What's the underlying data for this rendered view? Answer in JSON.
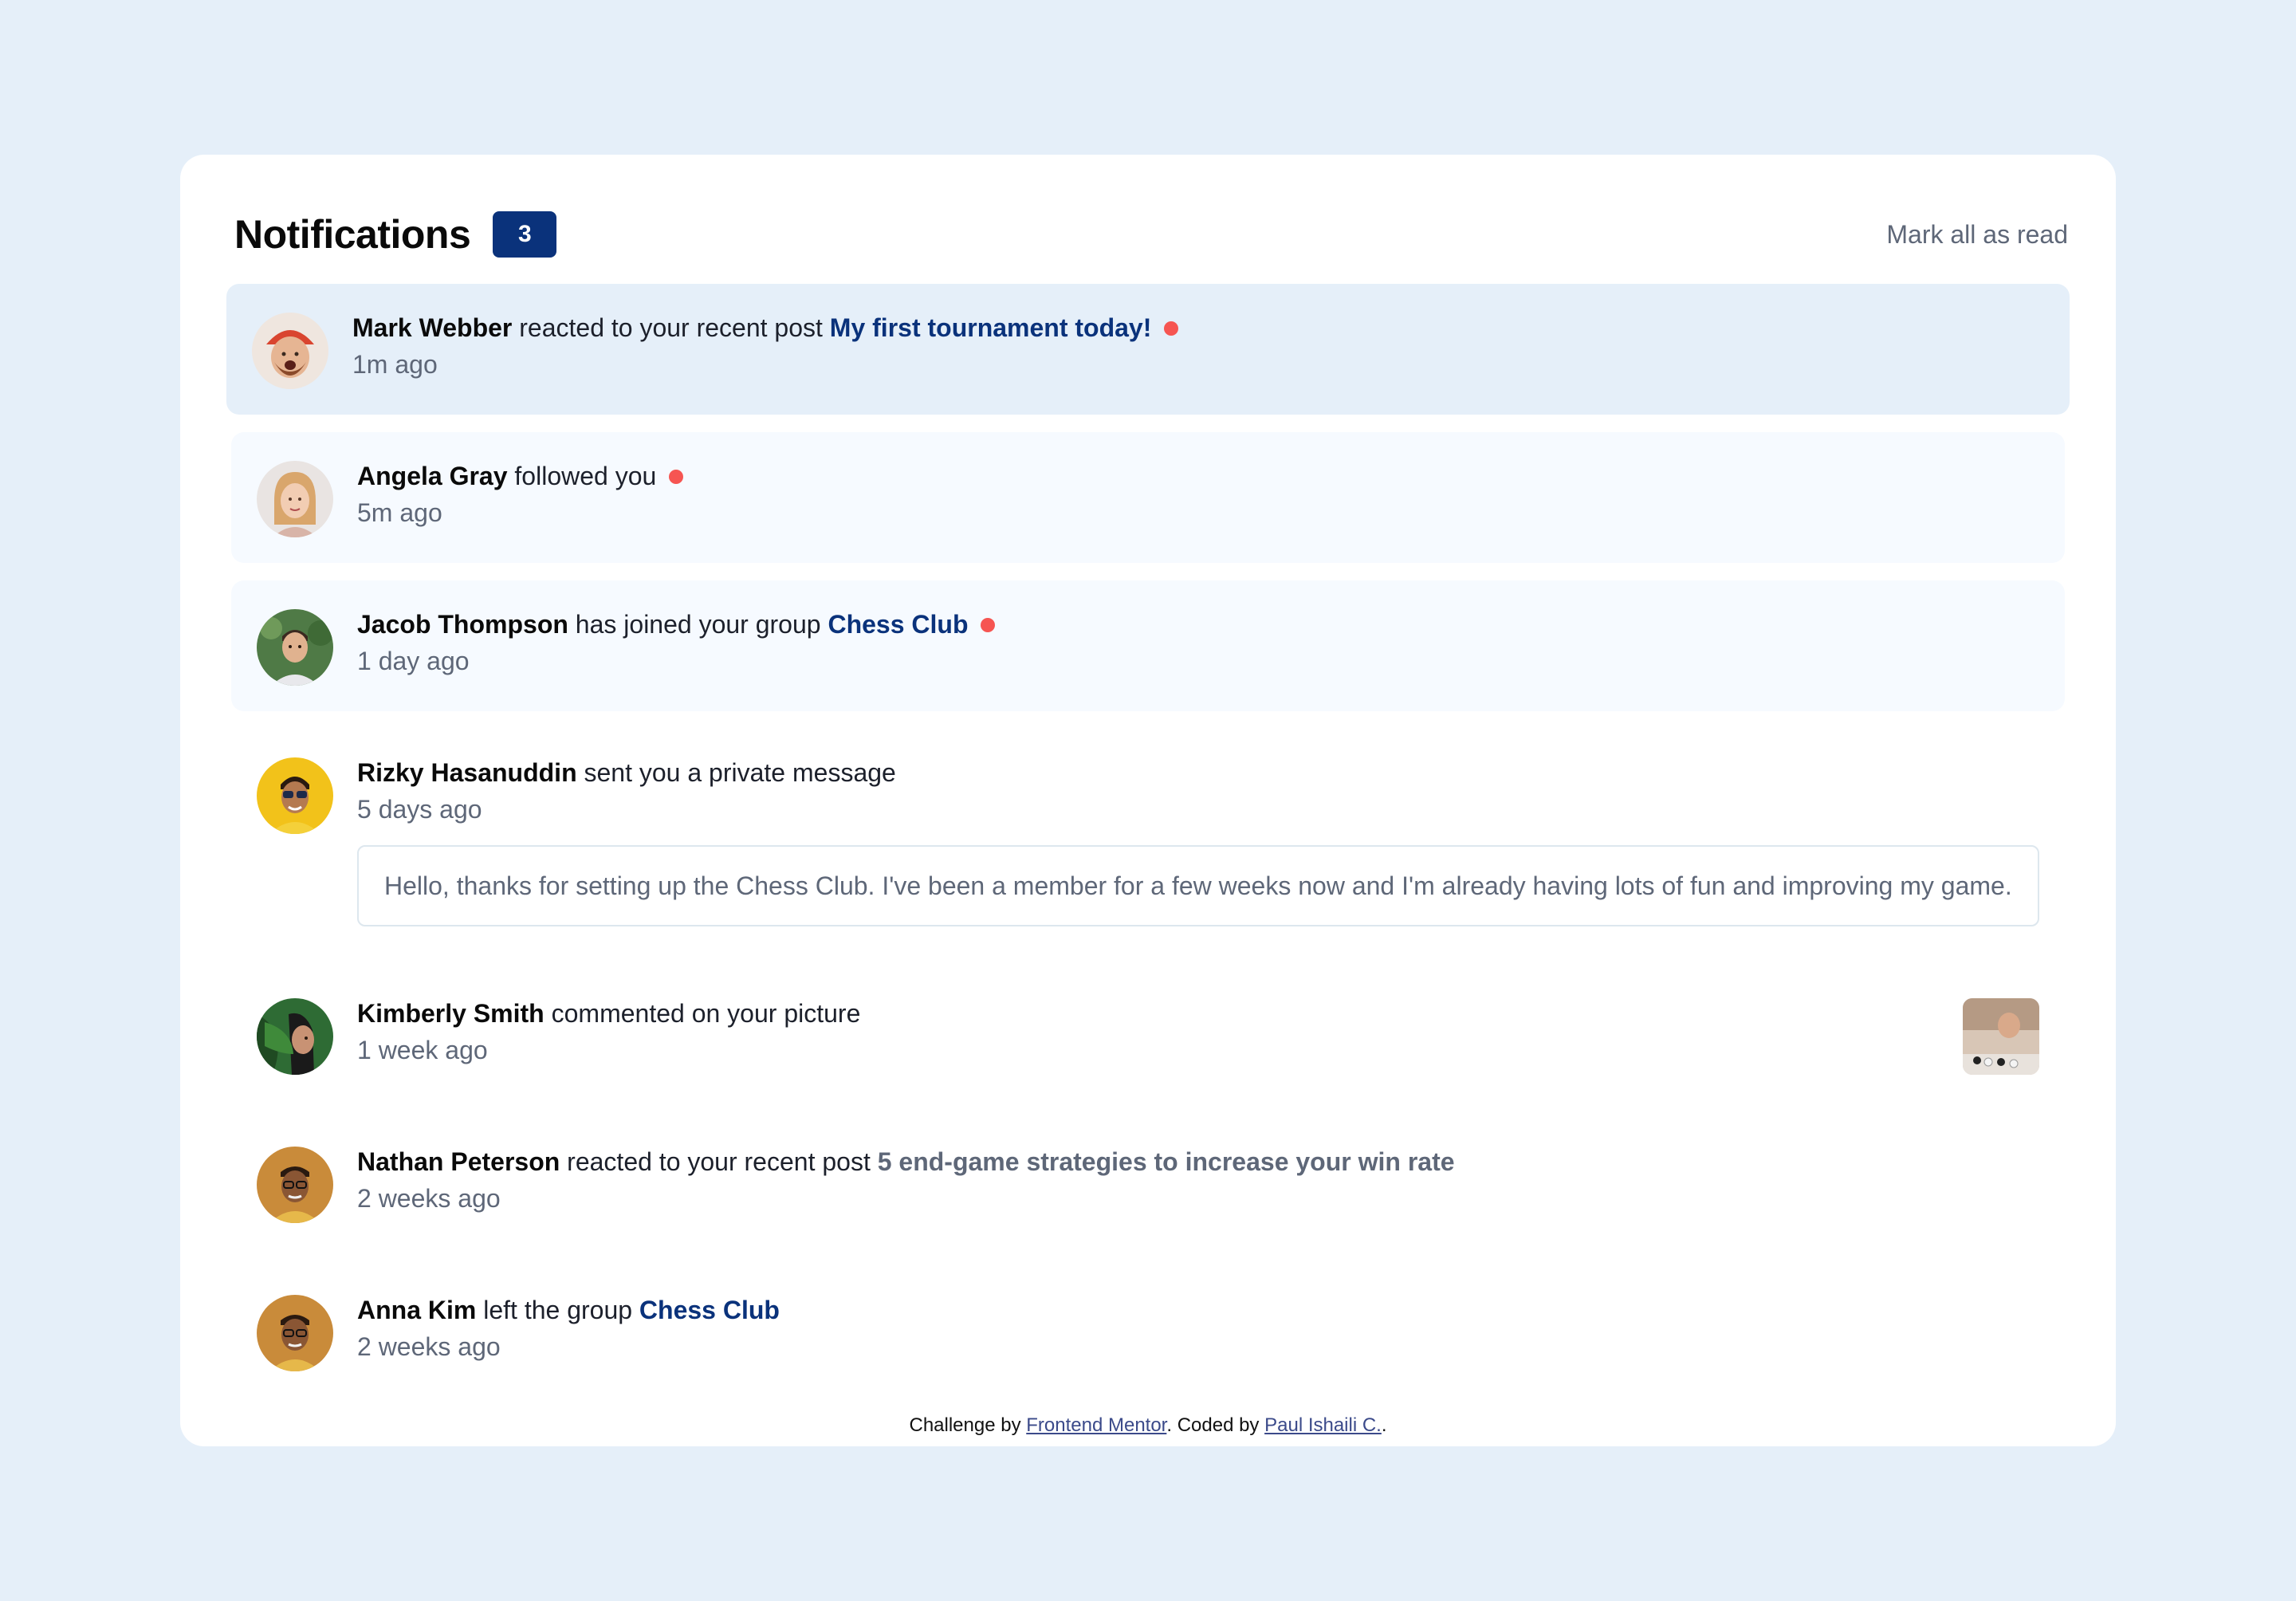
{
  "header": {
    "title": "Notifications",
    "unread_count": "3",
    "mark_all_label": "Mark all as read"
  },
  "notifications": [
    {
      "name": "Mark Webber",
      "action": " reacted to your recent post ",
      "target": "My first tournament today!",
      "time": "1m ago",
      "unread": true
    },
    {
      "name": "Angela Gray",
      "action": " followed you",
      "target": "",
      "time": "5m ago",
      "unread": true
    },
    {
      "name": "Jacob Thompson",
      "action": " has joined your group ",
      "target": "Chess Club",
      "time": "1 day ago",
      "unread": true
    },
    {
      "name": "Rizky Hasanuddin",
      "action": " sent you a private message",
      "target": "",
      "time": "5 days ago",
      "message": "Hello, thanks for setting up the Chess Club. I've been a member for a few weeks now and I'm already having lots of fun and improving my game.",
      "unread": false
    },
    {
      "name": "Kimberly Smith",
      "action": " commented on your picture",
      "target": "",
      "time": "1 week ago",
      "unread": false
    },
    {
      "name": "Nathan Peterson",
      "action": " reacted to your recent post ",
      "target": "5 end-game strategies to increase your win rate",
      "time": "2 weeks ago",
      "unread": false
    },
    {
      "name": "Anna Kim",
      "action": " left the group ",
      "target": "Chess Club",
      "time": "2 weeks ago",
      "unread": false
    }
  ],
  "footer": {
    "prefix": "Challenge by ",
    "link1": "Frontend Mentor",
    "middle": ". Coded by ",
    "link2": "Paul Ishaili C.",
    "suffix": "."
  },
  "colors": {
    "background": "#e5eff9",
    "card": "#ffffff",
    "accent": "#0a327b",
    "unread_dot": "#f65552",
    "muted_text": "#5e6778"
  }
}
